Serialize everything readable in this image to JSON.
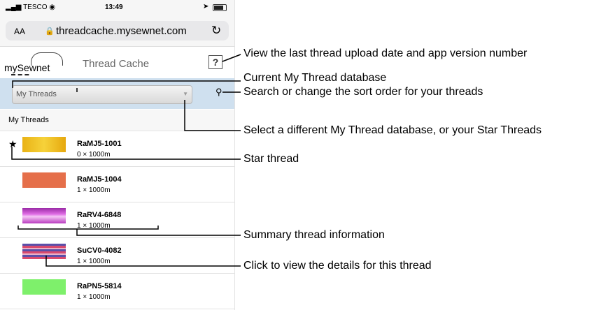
{
  "status": {
    "carrier": "TESCO",
    "time": "13:49"
  },
  "browser": {
    "text_size": "AA",
    "url": "threadcache.mysewnet.com"
  },
  "app": {
    "logo": "mySewnet",
    "title": "Thread Cache",
    "help": "?"
  },
  "database": {
    "selected": "My Threads"
  },
  "list_header": "My Threads",
  "threads": [
    {
      "code": "RaMJ5-1001",
      "qty": "0 × 1000m",
      "starred": true,
      "color": "#f2c21b"
    },
    {
      "code": "RaMJ5-1004",
      "qty": "1 × 1000m",
      "starred": false,
      "color": "#e56f4a"
    },
    {
      "code": "RaRV4-6848",
      "qty": "1 × 1000m",
      "starred": false,
      "color": "#c042c9"
    },
    {
      "code": "SuCV0-4082",
      "qty": "1 × 1000m",
      "starred": false,
      "color": "#c24f7a"
    },
    {
      "code": "RaPN5-5814",
      "qty": "1 × 1000m",
      "starred": false,
      "color": "#7ef06b"
    }
  ],
  "annotations": {
    "help": "View the last thread upload date and app version number",
    "current_db": "Current My Thread database",
    "search": "Search or change the sort order for your threads",
    "select_db": "Select a different My Thread database, or your Star Threads",
    "star": "Star thread",
    "summary": "Summary thread information",
    "details": "Click to view the details for this thread"
  }
}
